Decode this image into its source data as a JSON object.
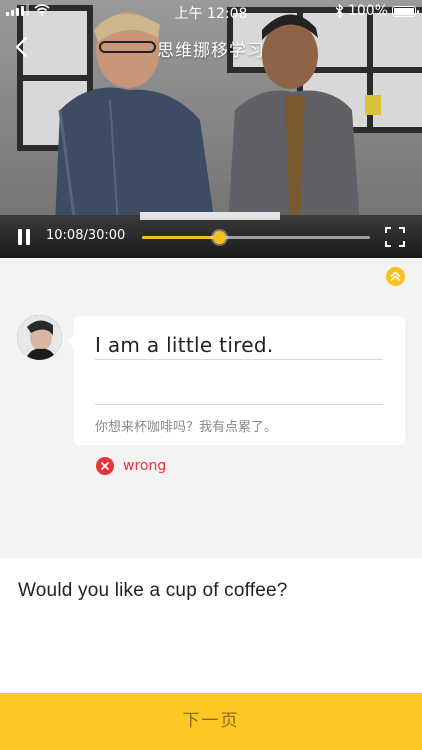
{
  "status_bar": {
    "time": "上午 12:08",
    "battery": "100%"
  },
  "video": {
    "title": "思维挪移学习",
    "time_display": "10:08/30:00",
    "progress_fraction": 0.336
  },
  "exercise": {
    "answer_text": "I am a little tired.",
    "input_value": "",
    "translation": "你想来杯咖啡吗？我有点累了。",
    "result_label": "wrong"
  },
  "question": {
    "text": "Would you like a cup of coffee?"
  },
  "footer": {
    "next_label": "下一页"
  },
  "colors": {
    "accent": "#fcc623",
    "progress": "#f7c21d",
    "error": "#e8333a"
  },
  "icons": [
    "back-icon",
    "pause-icon",
    "fullscreen-icon",
    "collapse-up-icon",
    "close-icon",
    "wifi-icon",
    "bluetooth-icon"
  ]
}
